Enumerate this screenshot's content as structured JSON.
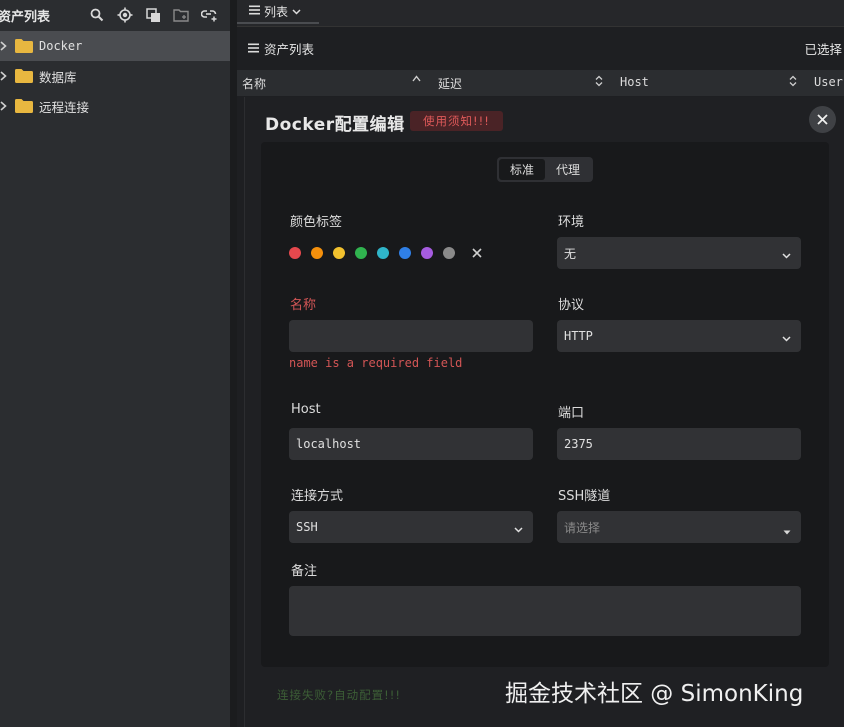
{
  "sidebar": {
    "title": "资产列表",
    "icons": [
      "search-icon",
      "locate-icon",
      "copy-icon",
      "folder-add-icon",
      "link-add-icon"
    ],
    "items": [
      {
        "label": "Docker",
        "selected": true
      },
      {
        "label": "数据库",
        "selected": false
      },
      {
        "label": "远程连接",
        "selected": false
      }
    ]
  },
  "tabs": [
    {
      "label": "列表",
      "active": true
    }
  ],
  "subheader": {
    "title": "资产列表",
    "selected_label": "已选择"
  },
  "table": {
    "columns": [
      "名称",
      "延迟",
      "Host",
      "User"
    ]
  },
  "modal": {
    "title": "Docker配置编辑",
    "notice_badge": "使用须知!!!",
    "mode_tabs": [
      "标准",
      "代理"
    ],
    "active_mode": "标准",
    "fields": {
      "color_tag_label": "颜色标签",
      "color_tags": [
        "#e5484d",
        "#f5900c",
        "#f2c12e",
        "#30b34f",
        "#2fb5c9",
        "#2f7fe6",
        "#a65ce0",
        "#8a8a8a"
      ],
      "env_label": "环境",
      "env_value": "无",
      "name_label": "名称",
      "name_value": "",
      "name_error": "name is a required field",
      "protocol_label": "协议",
      "protocol_value": "HTTP",
      "host_label": "Host",
      "host_value": "localhost",
      "port_label": "端口",
      "port_value": "2375",
      "conn_label": "连接方式",
      "conn_value": "SSH",
      "ssh_tunnel_label": "SSH隧道",
      "ssh_tunnel_placeholder": "请选择",
      "remark_label": "备注",
      "remark_value": ""
    },
    "footer_link": "连接失败?自动配置!!!"
  },
  "watermark": "掘金技术社区 @ SimonKing",
  "colors": {
    "error": "#d25555",
    "badge_bg": "#4a2326",
    "folder": "#e8b740"
  }
}
